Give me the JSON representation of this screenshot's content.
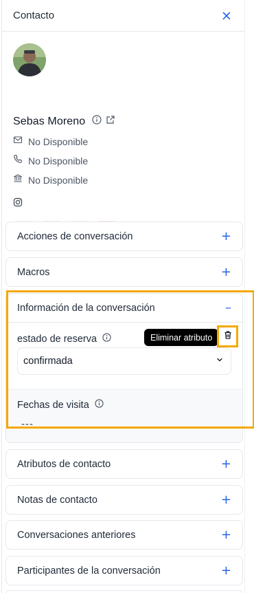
{
  "header": {
    "title": "Contacto"
  },
  "contact": {
    "name": "Sebas Moreno",
    "email": "No Disponible",
    "phone": "No Disponible",
    "company": "No Disponible"
  },
  "sections": {
    "acciones": "Acciones de conversación",
    "macros": "Macros",
    "informacion": "Información de la conversación",
    "atributos": "Atributos de contacto",
    "notas": "Notas de contacto",
    "anteriores": "Conversaciones anteriores",
    "participantes": "Participantes de la conversación"
  },
  "attributes": {
    "estado_label": "estado de reserva",
    "estado_value": "confirmada",
    "fechas_label": "Fechas de visita",
    "fechas_value": "---"
  },
  "tooltip": {
    "delete_attribute": "Eliminar atributo"
  },
  "colors": {
    "accent": "#2563eb",
    "highlight": "#f5a800",
    "danger_bg": "#fde7ea",
    "danger": "#e11d48"
  }
}
